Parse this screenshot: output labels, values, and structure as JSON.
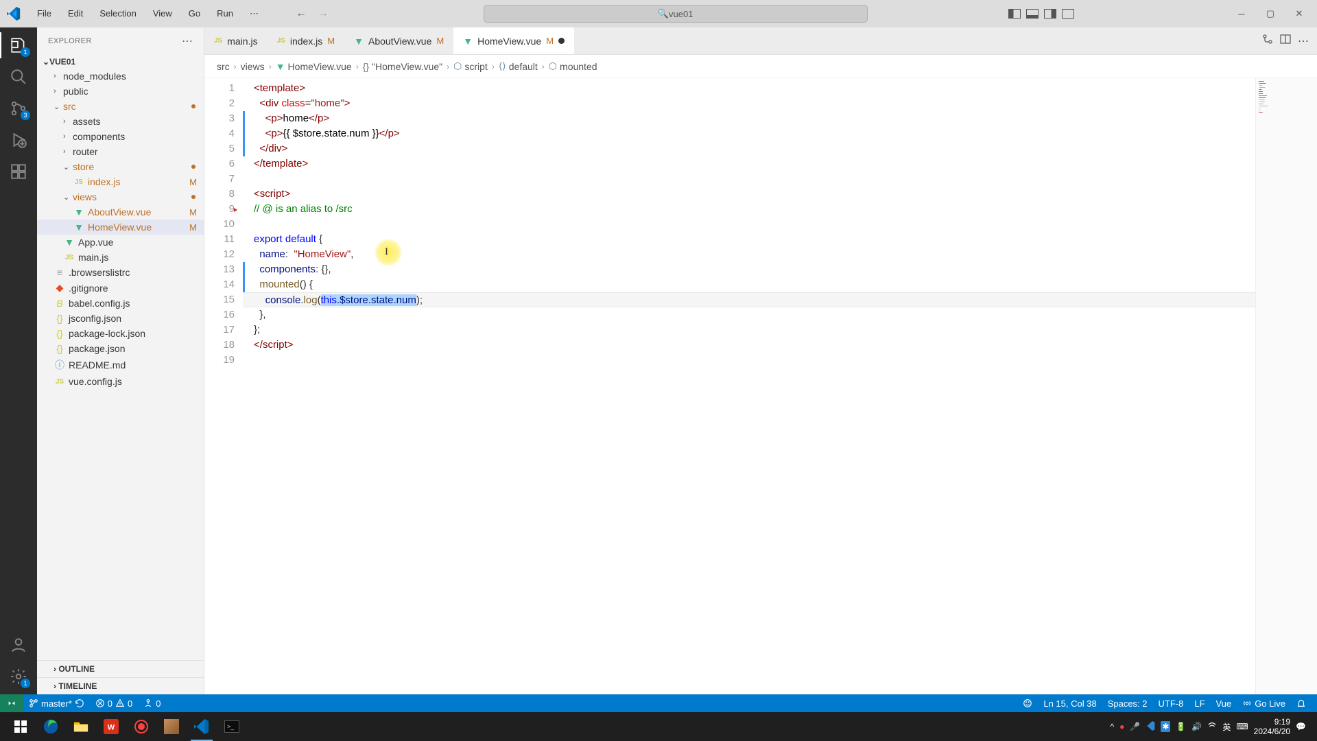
{
  "titlebar": {
    "menu": [
      "File",
      "Edit",
      "Selection",
      "View",
      "Go",
      "Run"
    ],
    "search": "vue01"
  },
  "activitybar": {
    "explorer_badge": "1",
    "scm_badge": "3",
    "settings_badge": "1"
  },
  "sidebar": {
    "title": "EXPLORER",
    "project": "VUE01",
    "outline": "OUTLINE",
    "timeline": "TIMELINE",
    "tree": {
      "node_modules": "node_modules",
      "public": "public",
      "src": "src",
      "assets": "assets",
      "components": "components",
      "router": "router",
      "store": "store",
      "store_index": "index.js",
      "views": "views",
      "aboutview": "AboutView.vue",
      "homeview": "HomeView.vue",
      "appvue": "App.vue",
      "mainjs": "main.js",
      "browserslist": ".browserslistrc",
      "gitignore": ".gitignore",
      "babel": "babel.config.js",
      "jsconfig": "jsconfig.json",
      "packagelock": "package-lock.json",
      "packagejson": "package.json",
      "readme": "README.md",
      "vueconfig": "vue.config.js"
    },
    "status_m": "M"
  },
  "tabs": [
    {
      "icon": "js",
      "name": "main.js",
      "mod": ""
    },
    {
      "icon": "js",
      "name": "index.js",
      "mod": "M"
    },
    {
      "icon": "vue",
      "name": "AboutView.vue",
      "mod": "M"
    },
    {
      "icon": "vue",
      "name": "HomeView.vue",
      "mod": "M",
      "active": true,
      "dirty": true
    }
  ],
  "breadcrumb": {
    "p1": "src",
    "p2": "views",
    "p3": "HomeView.vue",
    "p4": "\"HomeView.vue\"",
    "p5": "script",
    "p6": "default",
    "p7": "mounted"
  },
  "code": {
    "l1": {
      "a": "<template>"
    },
    "l2": {
      "a": "<div",
      "b": "class",
      "c": "\"home\"",
      "d": ">"
    },
    "l3": {
      "a": "<p>",
      "b": "home",
      "c": "</p>"
    },
    "l4": {
      "a": "<p>",
      "b": "{{ $store.state.num }}",
      "c": "</p>"
    },
    "l5": {
      "a": "</div>"
    },
    "l6": {
      "a": "</template>"
    },
    "l8": {
      "a": "<script>"
    },
    "l9": {
      "a": "// @ is an alias to /src"
    },
    "l11": {
      "a": "export",
      "b": "default",
      "c": "{"
    },
    "l12": {
      "a": "name",
      "b": ":",
      "c": "\"HomeView\"",
      "d": ","
    },
    "l13": {
      "a": "components",
      "b": ":",
      "c": "{},"
    },
    "l14": {
      "a": "mounted",
      "b": "() {"
    },
    "l15": {
      "a": "console",
      "b": ".",
      "c": "log",
      "d": "(",
      "e": "this",
      "f": ".$store.state.num",
      "g": ");"
    },
    "l16": {
      "a": "},"
    },
    "l17": {
      "a": "};"
    },
    "l18": {
      "a": "</",
      "b": "script",
      "c": ">"
    }
  },
  "statusbar": {
    "branch": "master*",
    "errors": "0",
    "warnings": "0",
    "radio": "0",
    "cursor": "Ln 15, Col 38",
    "spaces": "Spaces: 2",
    "encoding": "UTF-8",
    "eol": "LF",
    "lang": "Vue",
    "golive": "Go Live"
  },
  "taskbar": {
    "time": "9:19",
    "date": "2024/6/20",
    "ime1": "英",
    "ime_icon": "⌨"
  }
}
